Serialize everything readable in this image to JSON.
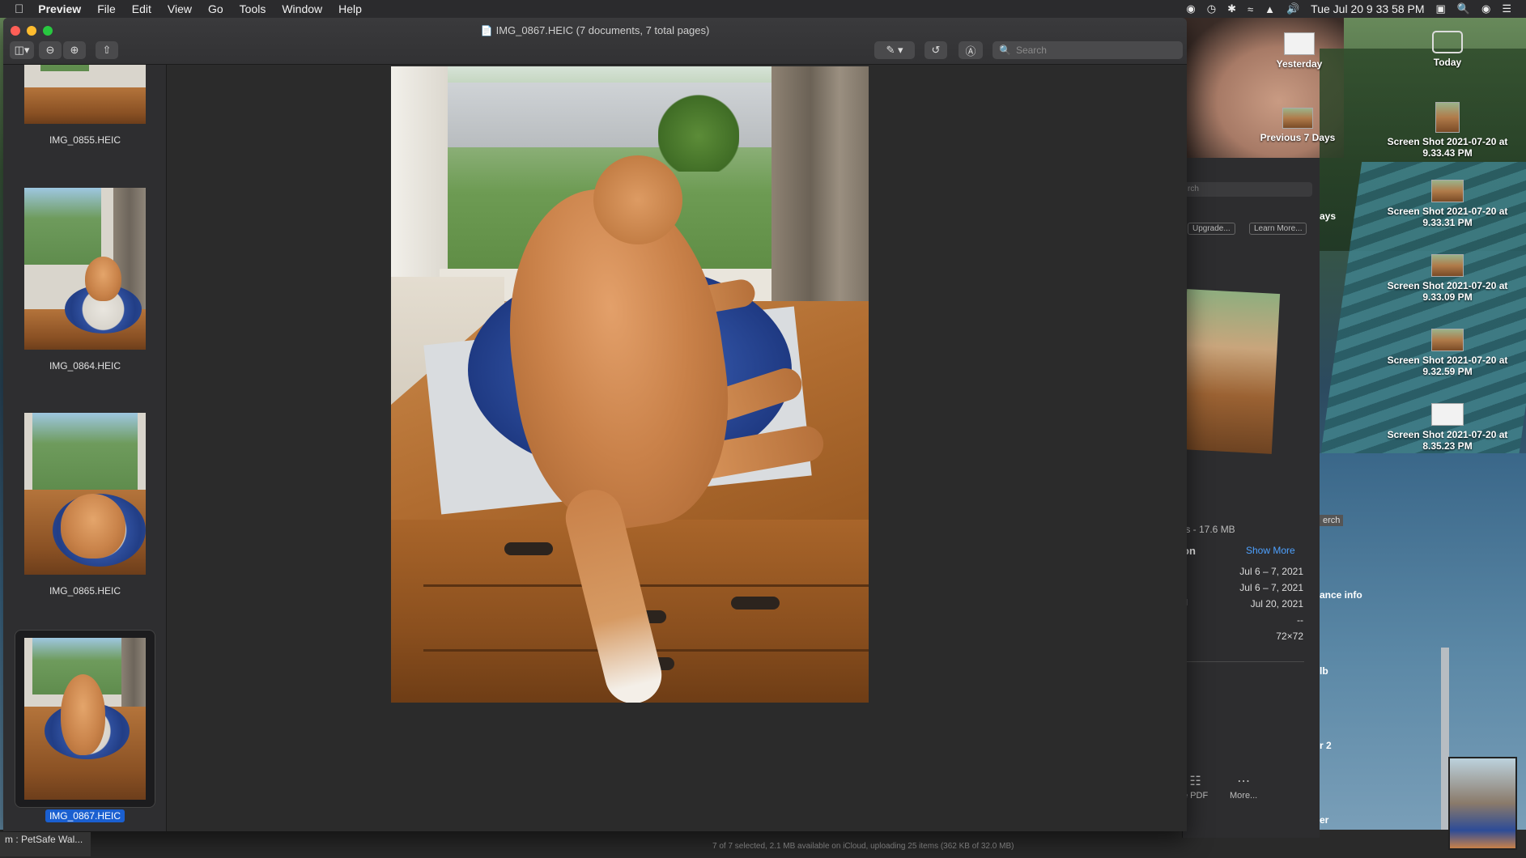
{
  "menubar": {
    "app_name": "Preview",
    "items": [
      "File",
      "Edit",
      "View",
      "Go",
      "Tools",
      "Window",
      "Help"
    ],
    "clock": "Tue Jul 20  9 33 58 PM"
  },
  "window": {
    "title": "IMG_0867.HEIC (7 documents, 7 total pages)",
    "search_placeholder": "Search"
  },
  "sidebar": {
    "items": [
      {
        "label": "IMG_0855.HEIC",
        "selected": false
      },
      {
        "label": "IMG_0864.HEIC",
        "selected": false
      },
      {
        "label": "IMG_0865.HEIC",
        "selected": false
      },
      {
        "label": "IMG_0867.HEIC",
        "selected": true
      }
    ]
  },
  "desktop_stacks": [
    {
      "label": "Yesterday"
    },
    {
      "label": "Today"
    },
    {
      "label": "Previous 7 Days"
    },
    {
      "label": "Screen Shot 2021-07-20 at 9.33.43 PM"
    },
    {
      "label": "Screen Shot 2021-07-20 at 9.33.31 PM"
    },
    {
      "label": "Screen Shot 2021-07-20 at 9.33.09 PM"
    },
    {
      "label": "Screen Shot 2021-07-20 at 9.32.59 PM"
    },
    {
      "label": "Screen Shot 2021-07-20 at 8.35.23 PM"
    }
  ],
  "finder": {
    "search_fragment": "rch",
    "upgrade_label": "Upgrade...",
    "learn_more_label": "Learn More...",
    "days_fragment": "ays",
    "size_text": "ts - 17.6 MB",
    "section_title": "on",
    "show_more": "Show More",
    "info_values": [
      "Jul 6 – 7, 2021",
      "Jul 6 – 7, 2021",
      "Jul 20, 2021",
      "--",
      "72×72"
    ],
    "info_key_fragment": "d",
    "side_fragments": [
      "erch",
      "ance info",
      "lb",
      "r 2",
      "er"
    ],
    "actions": [
      {
        "label": "e PDF",
        "icon": "document-icon"
      },
      {
        "label": "More...",
        "icon": "ellipsis-icon"
      }
    ]
  },
  "bottom": {
    "petsafe": "m : PetSafe Wal...",
    "status": "7 of 7 selected, 2.1 MB available on iCloud, uploading 25 items (362 KB of 32.0 MB)"
  }
}
